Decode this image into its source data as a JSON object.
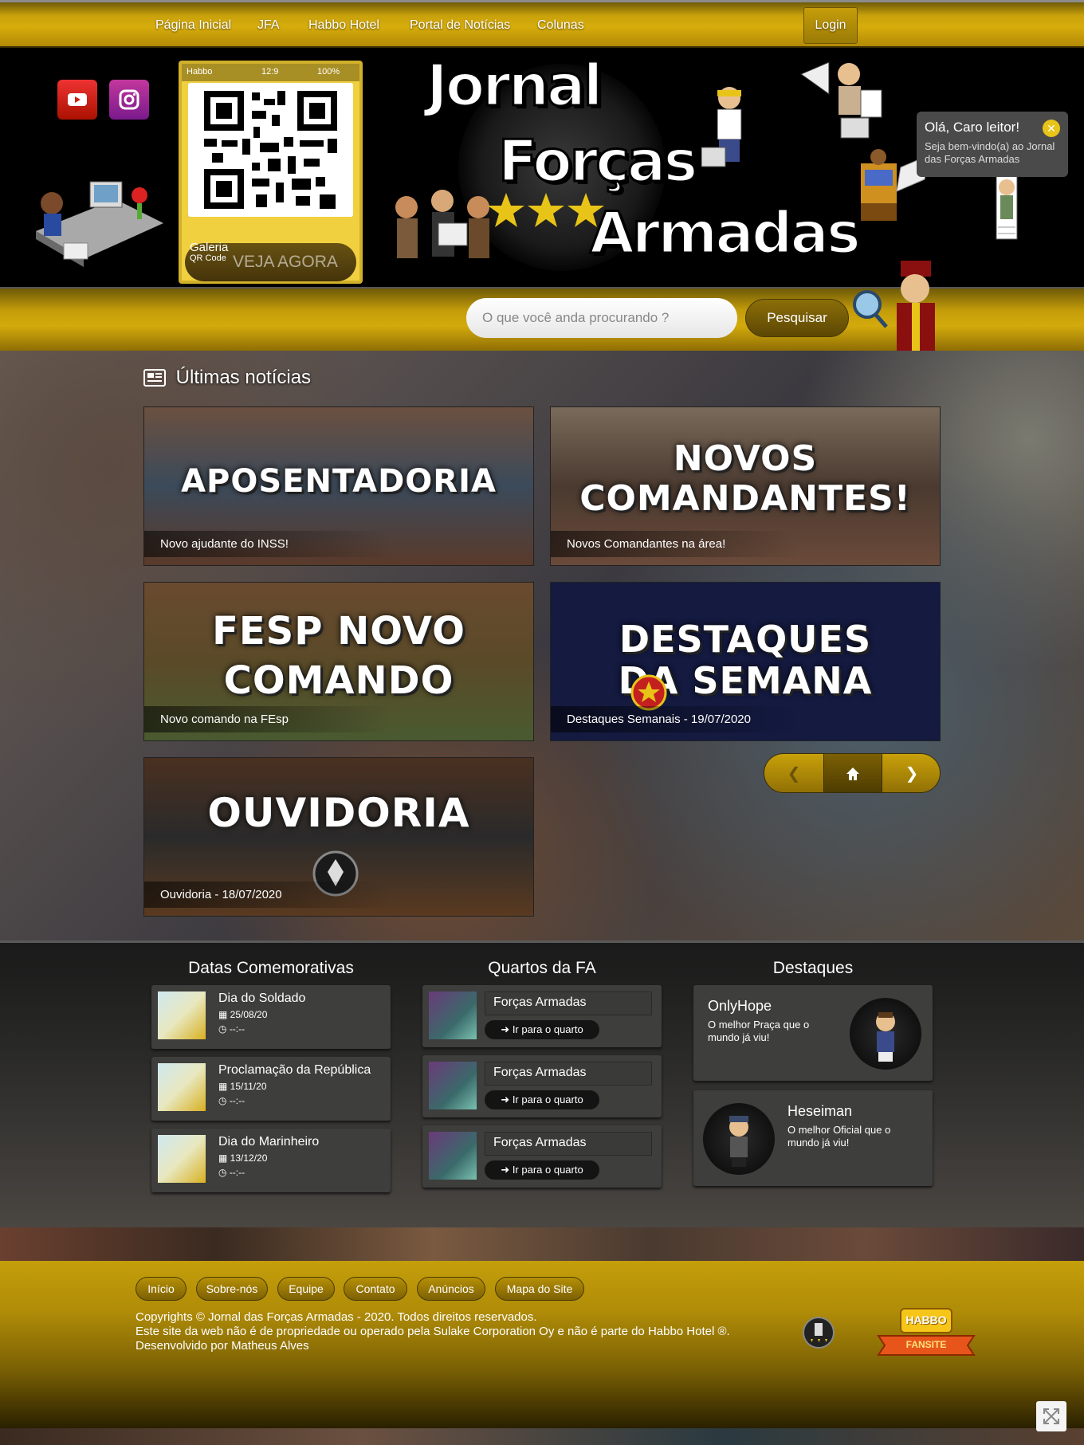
{
  "nav": {
    "items": [
      "Página Inicial",
      "JFA",
      "Habbo Hotel",
      "Portal de Notícias",
      "Colunas"
    ],
    "login": "Login"
  },
  "header": {
    "phone_carrier": "Habbo",
    "phone_time": "12:9",
    "phone_battery": "100%",
    "gallery_label": "Galeria",
    "qr_label": "QR Code",
    "see_now": "VEJA AGORA",
    "logo_lines": [
      "Jornal",
      "Forças",
      "Armadas"
    ],
    "welcome_title": "Olá, Caro leitor!",
    "welcome_text": "Seja bem-vindo(a) ao Jornal das Forças Armadas"
  },
  "search": {
    "placeholder": "O que você anda procurando ?",
    "button": "Pesquisar"
  },
  "news": {
    "title": "Últimas notícias",
    "cards": [
      {
        "banner": "APOSENTADORIA",
        "caption": "Novo ajudante do INSS!"
      },
      {
        "banner": "NOVOS COMANDANTES!",
        "caption": "Novos Comandantes na área!"
      },
      {
        "banner": "FESP NOVO COMANDO",
        "caption": "Novo comando na FEsp"
      },
      {
        "banner": "DESTAQUES DA SEMANA",
        "caption": "Destaques Semanais - 19/07/2020"
      },
      {
        "banner": "OUVIDORIA",
        "caption": "Ouvidoria - 18/07/2020"
      }
    ]
  },
  "dates": {
    "title": "Datas Comemorativas",
    "items": [
      {
        "name": "Dia do Soldado",
        "date": "25/08/20",
        "time": "--:--"
      },
      {
        "name": "Proclamação da República",
        "date": "15/11/20",
        "time": "--:--"
      },
      {
        "name": "Dia do Marinheiro",
        "date": "13/12/20",
        "time": "--:--"
      }
    ]
  },
  "rooms": {
    "title": "Quartos da FA",
    "items": [
      {
        "name": "Forças Armadas",
        "action": "Ir para o quarto"
      },
      {
        "name": "Forças Armadas",
        "action": "Ir para o quarto"
      },
      {
        "name": "Forças Armadas",
        "action": "Ir para o quarto"
      }
    ]
  },
  "highlights": {
    "title": "Destaques",
    "items": [
      {
        "name": "OnlyHope",
        "text": "O melhor Praça que o mundo já viu!"
      },
      {
        "name": "Heseiman",
        "text": "O melhor Oficial que o mundo já viu!"
      }
    ]
  },
  "footer": {
    "links": [
      "Início",
      "Sobre-nós",
      "Equipe",
      "Contato",
      "Anúncios",
      "Mapa do Site"
    ],
    "copyright": "Copyrights © Jornal das Forças Armadas - 2020. Todos direitos reservados.",
    "disclaimer": "Este site da web não é de propriedade ou operado pela Sulake Corporation Oy e não é parte do Habbo Hotel ®.",
    "developer": "Desenvolvido por Matheus Alves",
    "badge_top": "HABBO",
    "badge_bottom": "FANSITE"
  },
  "colors": {
    "gold": "#d7ad0c",
    "dark_gold": "#7c6004",
    "card_bg": "#3e3e3c"
  }
}
